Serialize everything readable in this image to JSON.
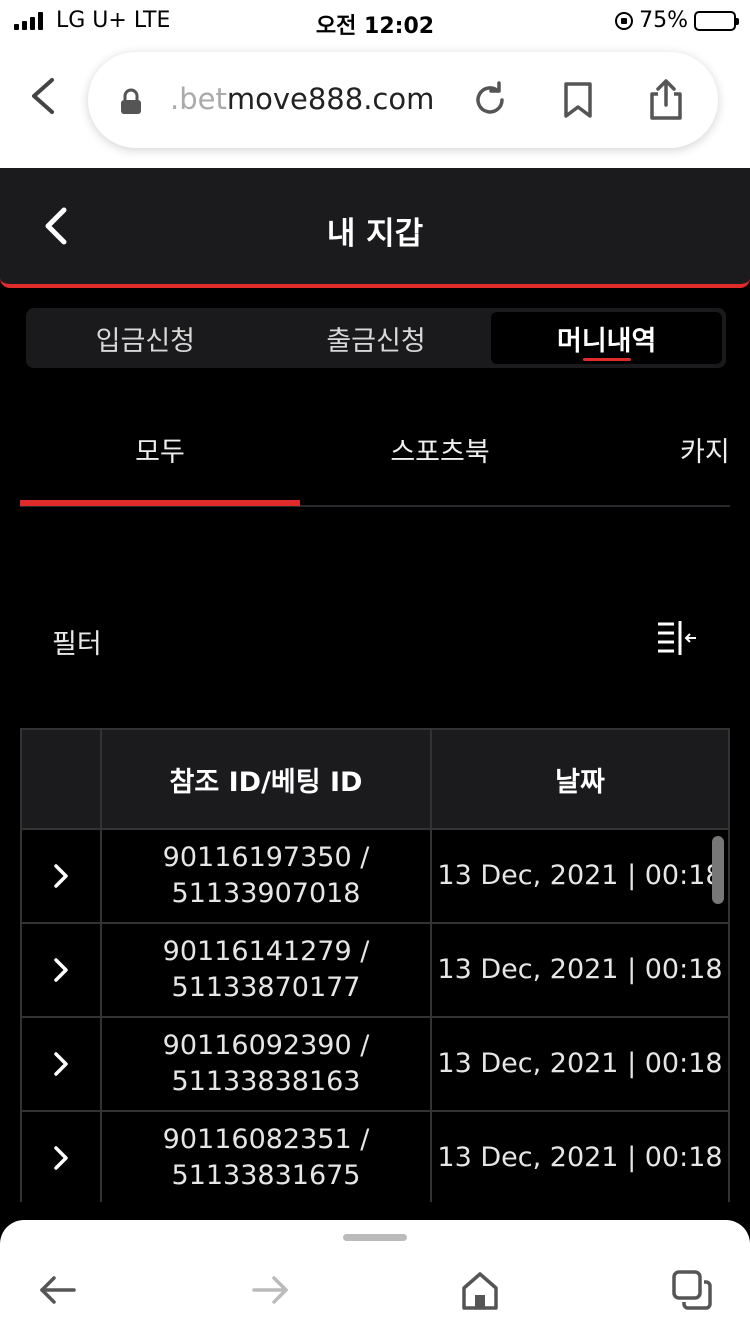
{
  "status_bar": {
    "carrier": "LG U+  LTE",
    "time": "오전 12:02",
    "battery": "75%",
    "battery_level": 0.75
  },
  "browser": {
    "url_faded": ".bet",
    "url_main": "move888.com"
  },
  "app": {
    "title": "내 지갑"
  },
  "wallet_tabs": [
    {
      "label": "입금신청",
      "active": false
    },
    {
      "label": "출금신청",
      "active": false
    },
    {
      "label": "머니내역",
      "active": true
    }
  ],
  "category_tabs": [
    {
      "label": "모두",
      "active": true
    },
    {
      "label": "스포츠북",
      "active": false
    },
    {
      "label": "카지",
      "active": false
    }
  ],
  "filter": {
    "label": "필터",
    "icon": "filter-sort-icon"
  },
  "table": {
    "headers": [
      "",
      "참조 ID/베팅 ID",
      "날짜"
    ],
    "rows": [
      {
        "ref_id": "90116197350 /",
        "bet_id": "51133907018",
        "date": "13 Dec, 2021 | 00:18"
      },
      {
        "ref_id": "90116141279 /",
        "bet_id": "51133870177",
        "date": "13 Dec, 2021 | 00:18"
      },
      {
        "ref_id": "90116092390 /",
        "bet_id": "51133838163",
        "date": "13 Dec, 2021 | 00:18"
      },
      {
        "ref_id": "90116082351 /",
        "bet_id": "51133831675",
        "date": "13 Dec, 2021 | 00:18"
      }
    ]
  },
  "colors": {
    "accent": "#e02b2b",
    "background": "#000000",
    "panel": "#1b1b1d"
  }
}
